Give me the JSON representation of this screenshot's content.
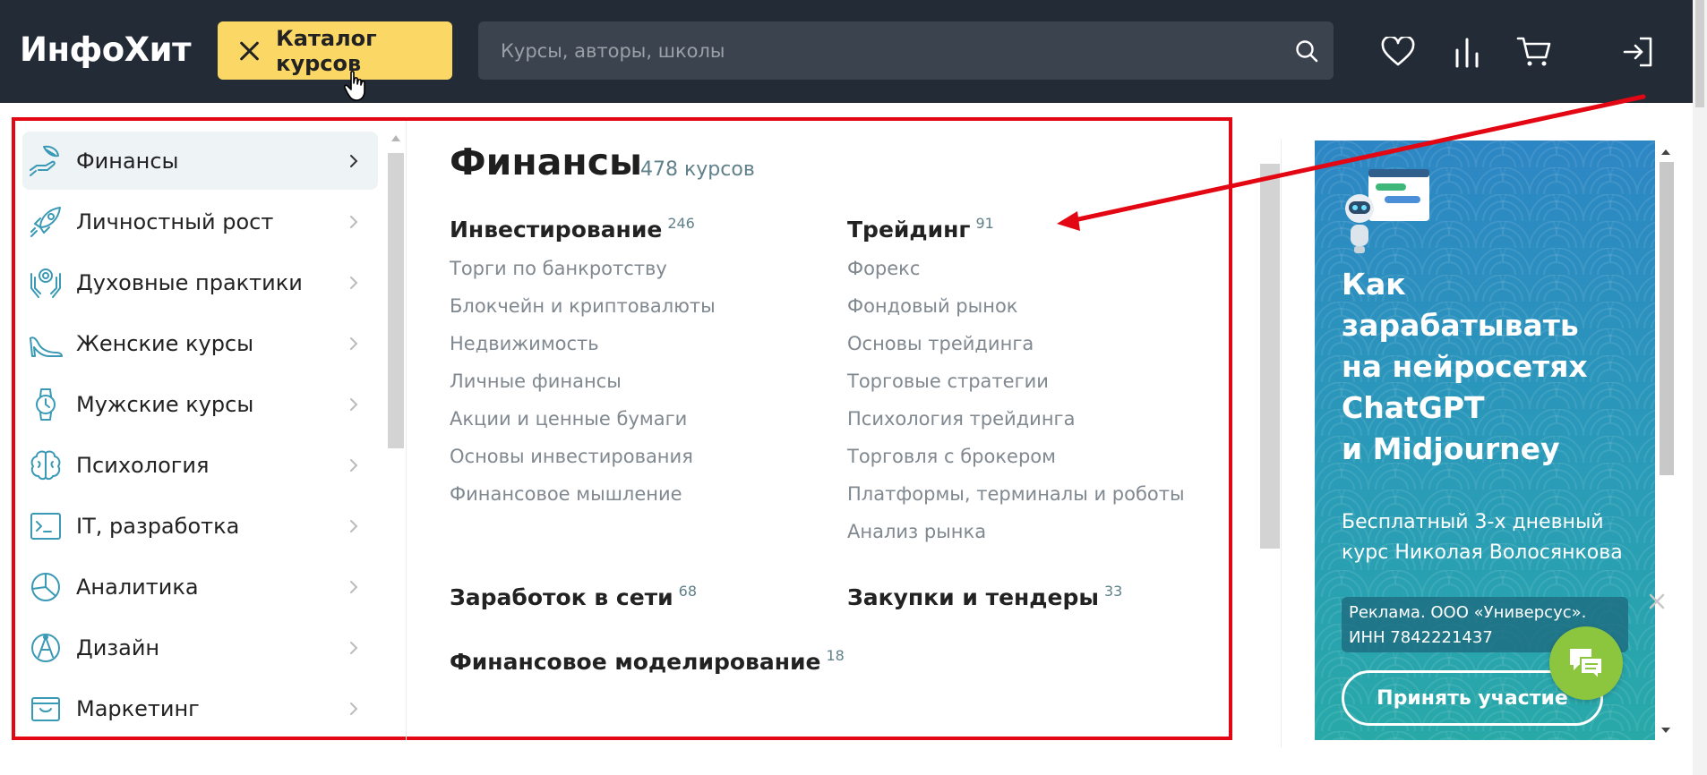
{
  "header": {
    "logo": "ИнфоХит",
    "catalog_button": "Каталог курсов",
    "search_placeholder": "Курсы, авторы, школы"
  },
  "sidebar": {
    "items": [
      {
        "label": "Финансы",
        "icon": "finance-hand-icon",
        "active": true
      },
      {
        "label": "Личностный рост",
        "icon": "rocket-icon",
        "active": false
      },
      {
        "label": "Духовные практики",
        "icon": "spiritual-hands-icon",
        "active": false
      },
      {
        "label": "Женские курсы",
        "icon": "high-heel-icon",
        "active": false
      },
      {
        "label": "Мужские курсы",
        "icon": "watch-icon",
        "active": false
      },
      {
        "label": "Психология",
        "icon": "brain-icon",
        "active": false
      },
      {
        "label": "IT, разработка",
        "icon": "terminal-icon",
        "active": false
      },
      {
        "label": "Аналитика",
        "icon": "pie-chart-icon",
        "active": false
      },
      {
        "label": "Дизайн",
        "icon": "design-icon",
        "active": false
      },
      {
        "label": "Маркетинг",
        "icon": "box-icon",
        "active": false
      }
    ]
  },
  "main": {
    "title": "Финансы",
    "count": "478 курсов",
    "groups": [
      {
        "title": "Инвестирование",
        "count": "246",
        "links": [
          "Торги по банкротству",
          "Блокчейн и криптовалюты",
          "Недвижимость",
          "Личные финансы",
          "Акции и ценные бумаги",
          "Основы инвестирования",
          "Финансовое мышление"
        ]
      },
      {
        "title": "Трейдинг",
        "count": "91",
        "links": [
          "Форекс",
          "Фондовый рынок",
          "Основы трейдинга",
          "Торговые стратегии",
          "Психология трейдинга",
          "Торговля с брокером",
          "Платформы, терминалы и роботы",
          "Анализ рынка"
        ]
      },
      {
        "title": "Заработок в сети",
        "count": "68",
        "links": []
      },
      {
        "title": "Закупки и тендеры",
        "count": "33",
        "links": []
      },
      {
        "title": "Финансовое моделирование",
        "count": "18",
        "links": []
      }
    ]
  },
  "ad": {
    "title_lines": [
      "Как",
      "зарабатывать",
      "на нейросетях",
      "ChatGPT",
      "и Midjourney"
    ],
    "subtitle_lines": [
      "Бесплатный 3-х дневный",
      "курс Николая Волосянкова"
    ],
    "note_lines": [
      "Реклама. ООО «Универсус».",
      "ИНН 7842221437"
    ],
    "button": "Принять участие"
  },
  "colors": {
    "topbar": "#232b37",
    "catalog_button": "#fbd866",
    "highlight_box": "#e30613",
    "count_text": "#60808a",
    "ad_background": "#2a8ec0",
    "chat_button": "#8cc63f"
  }
}
